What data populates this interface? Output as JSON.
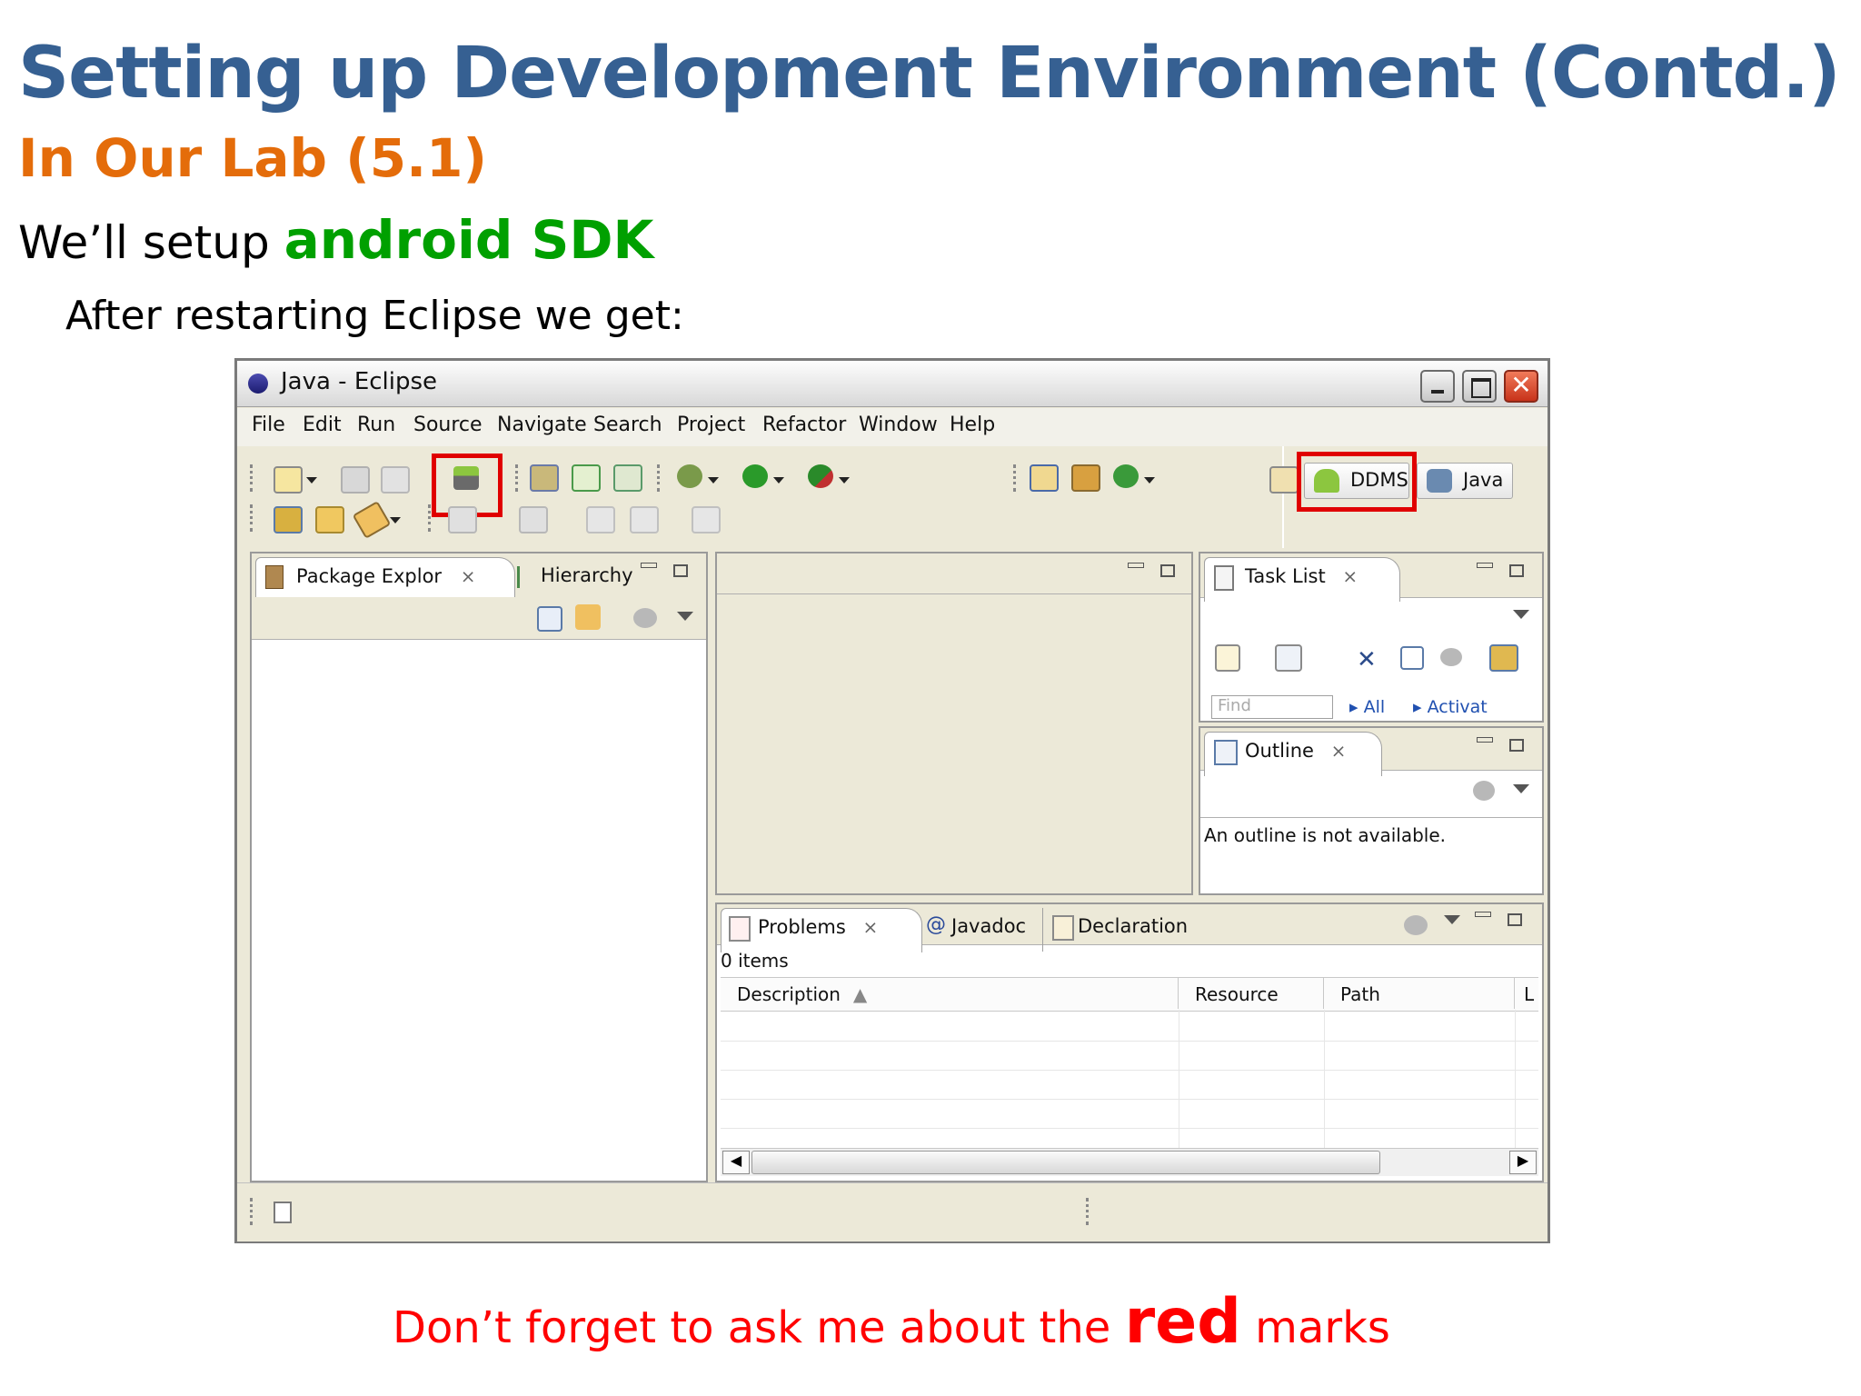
{
  "slide": {
    "title": "Setting up Development Environment (Contd.)",
    "subtitle": "In Our Lab (5.1)",
    "line_prefix": "We’ll setup ",
    "line_highlight": "android SDK",
    "indent_text": "After restarting Eclipse we get:",
    "footnote_prefix": "Don’t forget to ask me about the ",
    "footnote_highlight": "red",
    "footnote_suffix": " marks"
  },
  "window": {
    "title": "Java - Eclipse",
    "close_glyph": "✕"
  },
  "menu": [
    "File",
    "Edit",
    "Run",
    "Source",
    "Navigate",
    "Search",
    "Project",
    "Refactor",
    "Window",
    "Help"
  ],
  "perspectives": {
    "ddms": "DDMS",
    "java": "Java"
  },
  "package_explorer": {
    "tab_package": "Package Explor",
    "tab_hierarchy": "Hierarchy"
  },
  "task_list": {
    "tab": "Task List",
    "find_placeholder": "Find",
    "all_link": "All",
    "activate_link": "Activat"
  },
  "outline": {
    "tab": "Outline",
    "message": "An outline is not available."
  },
  "problems": {
    "tabs": [
      "Problems",
      "Javadoc",
      "Declaration"
    ],
    "count": "0 items",
    "columns": [
      "Description",
      "Resource",
      "Path",
      "L"
    ]
  },
  "colors": {
    "title_blue": "#366092",
    "subtitle_orange": "#e46c0a",
    "sdk_green": "#00a000",
    "red_mark": "#e00000",
    "window_bg": "#ece9d8"
  }
}
